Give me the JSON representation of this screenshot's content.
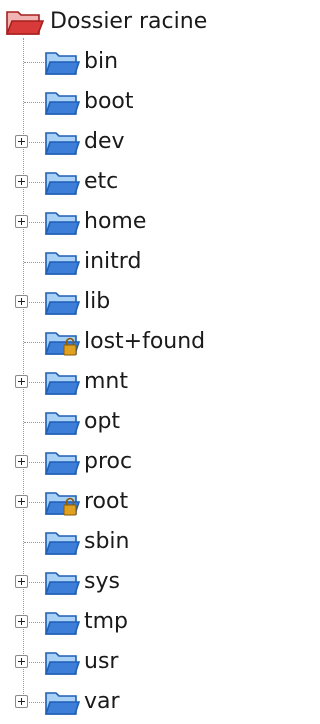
{
  "tree": {
    "root": {
      "label": "Dossier racine",
      "icon": "folder-open-red-icon"
    },
    "items": [
      {
        "label": "bin",
        "expandable": false,
        "locked": false
      },
      {
        "label": "boot",
        "expandable": false,
        "locked": false
      },
      {
        "label": "dev",
        "expandable": true,
        "locked": false
      },
      {
        "label": "etc",
        "expandable": true,
        "locked": false
      },
      {
        "label": "home",
        "expandable": true,
        "locked": false
      },
      {
        "label": "initrd",
        "expandable": false,
        "locked": false
      },
      {
        "label": "lib",
        "expandable": true,
        "locked": false
      },
      {
        "label": "lost+found",
        "expandable": false,
        "locked": true
      },
      {
        "label": "mnt",
        "expandable": true,
        "locked": false
      },
      {
        "label": "opt",
        "expandable": false,
        "locked": false
      },
      {
        "label": "proc",
        "expandable": true,
        "locked": false
      },
      {
        "label": "root",
        "expandable": true,
        "locked": true
      },
      {
        "label": "sbin",
        "expandable": false,
        "locked": false
      },
      {
        "label": "sys",
        "expandable": true,
        "locked": false
      },
      {
        "label": "tmp",
        "expandable": true,
        "locked": false
      },
      {
        "label": "usr",
        "expandable": true,
        "locked": false
      },
      {
        "label": "var",
        "expandable": true,
        "locked": false
      }
    ]
  },
  "colors": {
    "folder_blue": "#3d7fd8",
    "folder_blue_light": "#a9d0f5",
    "folder_red": "#d83a3a",
    "lock_gold": "#e0a020"
  }
}
